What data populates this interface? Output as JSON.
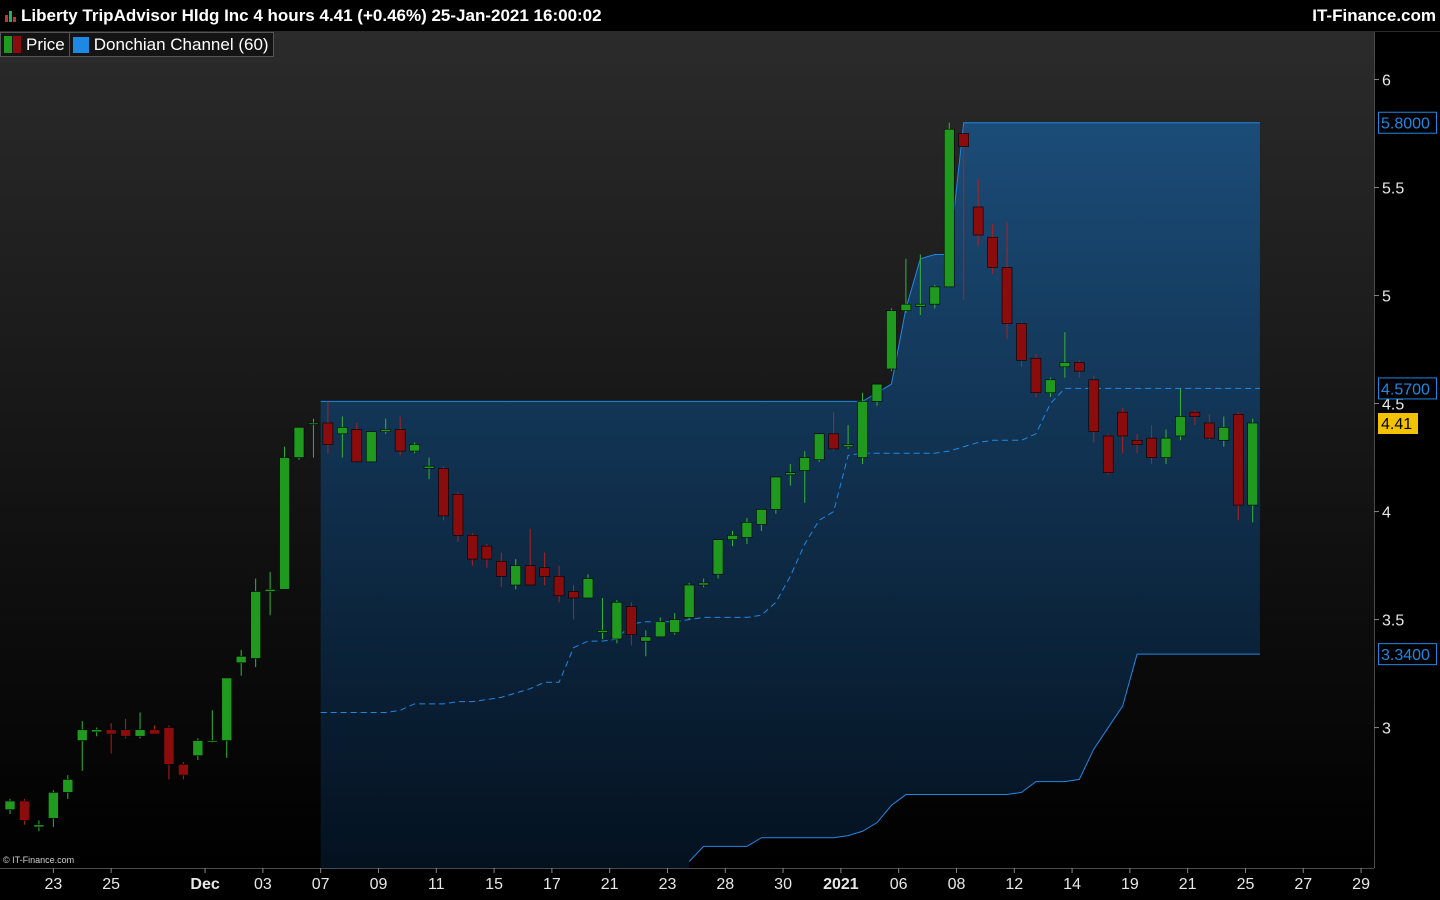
{
  "header": {
    "title": "Liberty TripAdvisor Hldg Inc 4 hours 4.41 (+0.46%) 25-Jan-2021 16:00:02",
    "brand": "IT-Finance.com"
  },
  "legend": [
    {
      "label": "Price",
      "icon": "candlestick-icon"
    },
    {
      "label": "Donchian Channel (60)",
      "icon": "blue-square-icon",
      "color": "#1e88e5"
    }
  ],
  "copyright": "© IT-Finance.com",
  "colors": {
    "up": "#1f9a1f",
    "down": "#8a0c0c",
    "channel": "#1e88e5",
    "last_price_bg": "#f2c200"
  },
  "chart_data": {
    "type": "candlestick",
    "title": "Liberty TripAdvisor Hldg Inc 4 hours",
    "ylim": [
      2.35,
      6.22
    ],
    "y_ticks": [
      {
        "value": 3,
        "label": "3"
      },
      {
        "value": 3.5,
        "label": "3.5"
      },
      {
        "value": 4,
        "label": "4"
      },
      {
        "value": 4.5,
        "label": "4.5"
      },
      {
        "value": 5,
        "label": "5"
      },
      {
        "value": 5.5,
        "label": "5.5"
      },
      {
        "value": 6,
        "label": "6"
      }
    ],
    "x_ticks": [
      {
        "index": 3,
        "label": "23",
        "bold": false
      },
      {
        "index": 7,
        "label": "25",
        "bold": false
      },
      {
        "index": 13.5,
        "label": "Dec",
        "bold": true
      },
      {
        "index": 17.5,
        "label": "03",
        "bold": false
      },
      {
        "index": 21.5,
        "label": "07",
        "bold": false
      },
      {
        "index": 25.5,
        "label": "09",
        "bold": false
      },
      {
        "index": 29.5,
        "label": "11",
        "bold": false
      },
      {
        "index": 33.5,
        "label": "15",
        "bold": false
      },
      {
        "index": 37.5,
        "label": "17",
        "bold": false
      },
      {
        "index": 41.5,
        "label": "21",
        "bold": false
      },
      {
        "index": 45.5,
        "label": "23",
        "bold": false
      },
      {
        "index": 49.5,
        "label": "28",
        "bold": false
      },
      {
        "index": 53.5,
        "label": "30",
        "bold": false
      },
      {
        "index": 57.5,
        "label": "2021",
        "bold": true
      },
      {
        "index": 61.5,
        "label": "06",
        "bold": false
      },
      {
        "index": 65.5,
        "label": "08",
        "bold": false
      },
      {
        "index": 69.5,
        "label": "12",
        "bold": false
      },
      {
        "index": 73.5,
        "label": "14",
        "bold": false
      },
      {
        "index": 77.5,
        "label": "19",
        "bold": false
      },
      {
        "index": 81.5,
        "label": "21",
        "bold": false
      },
      {
        "index": 85.5,
        "label": "25",
        "bold": false
      },
      {
        "index": 89.5,
        "label": "27",
        "bold": false
      },
      {
        "index": 93.5,
        "label": "29",
        "bold": false
      }
    ],
    "candles": [
      [
        2.62,
        2.67,
        2.6,
        2.66
      ],
      [
        2.66,
        2.67,
        2.55,
        2.57
      ],
      [
        2.54,
        2.57,
        2.52,
        2.55
      ],
      [
        2.58,
        2.71,
        2.54,
        2.7
      ],
      [
        2.7,
        2.78,
        2.67,
        2.76
      ],
      [
        2.94,
        3.03,
        2.8,
        2.99
      ],
      [
        2.98,
        3.0,
        2.96,
        2.99
      ],
      [
        2.99,
        3.02,
        2.88,
        2.97
      ],
      [
        2.99,
        3.04,
        2.95,
        2.96
      ],
      [
        2.96,
        3.07,
        2.95,
        2.99
      ],
      [
        2.99,
        3.01,
        2.97,
        2.97
      ],
      [
        3.0,
        3.01,
        2.76,
        2.83
      ],
      [
        2.83,
        2.84,
        2.76,
        2.78
      ],
      [
        2.87,
        2.95,
        2.85,
        2.94
      ],
      [
        2.94,
        3.08,
        2.93,
        2.94
      ],
      [
        2.94,
        3.23,
        2.86,
        3.23
      ],
      [
        3.3,
        3.36,
        3.24,
        3.33
      ],
      [
        3.32,
        3.69,
        3.28,
        3.63
      ],
      [
        3.63,
        3.72,
        3.52,
        3.64
      ],
      [
        3.64,
        4.3,
        3.64,
        4.25
      ],
      [
        4.25,
        4.39,
        4.24,
        4.39
      ],
      [
        4.41,
        4.43,
        4.25,
        4.41
      ],
      [
        4.41,
        4.51,
        4.27,
        4.31
      ],
      [
        4.36,
        4.44,
        4.25,
        4.39
      ],
      [
        4.38,
        4.41,
        4.25,
        4.23
      ],
      [
        4.23,
        4.37,
        4.25,
        4.37
      ],
      [
        4.37,
        4.43,
        4.36,
        4.38
      ],
      [
        4.38,
        4.44,
        4.26,
        4.28
      ],
      [
        4.28,
        4.32,
        4.27,
        4.31
      ],
      [
        4.2,
        4.25,
        4.15,
        4.21
      ],
      [
        4.2,
        4.21,
        3.96,
        3.98
      ],
      [
        4.08,
        4.09,
        3.86,
        3.89
      ],
      [
        3.89,
        3.9,
        3.75,
        3.78
      ],
      [
        3.84,
        3.85,
        3.74,
        3.78
      ],
      [
        3.77,
        3.81,
        3.65,
        3.7
      ],
      [
        3.66,
        3.78,
        3.64,
        3.75
      ],
      [
        3.75,
        3.92,
        3.72,
        3.66
      ],
      [
        3.74,
        3.81,
        3.66,
        3.7
      ],
      [
        3.7,
        3.75,
        3.58,
        3.61
      ],
      [
        3.63,
        3.66,
        3.5,
        3.6
      ],
      [
        3.6,
        3.71,
        3.6,
        3.69
      ],
      [
        3.44,
        3.6,
        3.41,
        3.45
      ],
      [
        3.41,
        3.59,
        3.39,
        3.58
      ],
      [
        3.56,
        3.58,
        3.38,
        3.43
      ],
      [
        3.4,
        3.45,
        3.33,
        3.42
      ],
      [
        3.42,
        3.51,
        3.42,
        3.49
      ],
      [
        3.44,
        3.53,
        3.43,
        3.5
      ],
      [
        3.51,
        3.67,
        3.5,
        3.66
      ],
      [
        3.66,
        3.69,
        3.65,
        3.67
      ],
      [
        3.71,
        3.87,
        3.69,
        3.87
      ],
      [
        3.87,
        3.91,
        3.84,
        3.89
      ],
      [
        3.88,
        3.97,
        3.85,
        3.95
      ],
      [
        3.94,
        4.0,
        3.91,
        4.01
      ],
      [
        4.01,
        4.16,
        3.99,
        4.16
      ],
      [
        4.17,
        4.22,
        4.12,
        4.18
      ],
      [
        4.19,
        4.28,
        4.04,
        4.25
      ],
      [
        4.24,
        4.36,
        4.23,
        4.36
      ],
      [
        4.36,
        4.46,
        4.28,
        4.29
      ],
      [
        4.3,
        4.4,
        4.29,
        4.31
      ],
      [
        4.25,
        4.55,
        4.22,
        4.51
      ],
      [
        4.51,
        4.59,
        4.49,
        4.59
      ],
      [
        4.66,
        4.94,
        4.65,
        4.93
      ],
      [
        4.93,
        5.17,
        4.92,
        4.96
      ],
      [
        4.95,
        5.19,
        4.91,
        4.96
      ],
      [
        4.96,
        5.05,
        4.94,
        5.04
      ],
      [
        5.04,
        5.8,
        5.04,
        5.77
      ],
      [
        5.75,
        5.78,
        4.98,
        5.69
      ],
      [
        5.41,
        5.54,
        5.23,
        5.28
      ],
      [
        5.27,
        5.33,
        5.1,
        5.13
      ],
      [
        5.13,
        5.34,
        4.8,
        4.87
      ],
      [
        4.87,
        4.88,
        4.67,
        4.7
      ],
      [
        4.71,
        4.73,
        4.53,
        4.55
      ],
      [
        4.55,
        4.62,
        4.53,
        4.61
      ],
      [
        4.67,
        4.83,
        4.62,
        4.69
      ],
      [
        4.69,
        4.7,
        4.62,
        4.65
      ],
      [
        4.61,
        4.63,
        4.32,
        4.37
      ],
      [
        4.35,
        4.36,
        4.17,
        4.18
      ],
      [
        4.46,
        4.48,
        4.27,
        4.35
      ],
      [
        4.33,
        4.36,
        4.27,
        4.31
      ],
      [
        4.34,
        4.4,
        4.22,
        4.25
      ],
      [
        4.25,
        4.38,
        4.22,
        4.34
      ],
      [
        4.35,
        4.57,
        4.33,
        4.44
      ],
      [
        4.46,
        4.47,
        4.4,
        4.44
      ],
      [
        4.41,
        4.45,
        4.33,
        4.34
      ],
      [
        4.33,
        4.44,
        4.3,
        4.39
      ],
      [
        4.45,
        4.46,
        3.96,
        4.03
      ],
      [
        4.03,
        4.43,
        3.95,
        4.41
      ]
    ],
    "donchian_start_index": 22,
    "donchian_upper": [
      4.51,
      4.51,
      4.51,
      4.51,
      4.51,
      4.51,
      4.51,
      4.51,
      4.51,
      4.51,
      4.51,
      4.51,
      4.51,
      4.51,
      4.51,
      4.51,
      4.51,
      4.51,
      4.51,
      4.51,
      4.51,
      4.51,
      4.51,
      4.51,
      4.51,
      4.51,
      4.51,
      4.51,
      4.51,
      4.51,
      4.51,
      4.51,
      4.51,
      4.51,
      4.51,
      4.51,
      4.51,
      4.51,
      4.55,
      4.59,
      4.94,
      5.17,
      5.19,
      5.19,
      5.8,
      5.8,
      5.8,
      5.8,
      5.8,
      5.8,
      5.8,
      5.8,
      5.8,
      5.8,
      5.8,
      5.8,
      5.8,
      5.8,
      5.8,
      5.8,
      5.8,
      5.8,
      5.8,
      5.8,
      5.8
    ],
    "donchian_lower": [
      null,
      null,
      null,
      null,
      null,
      null,
      null,
      null,
      null,
      null,
      null,
      null,
      null,
      null,
      null,
      null,
      null,
      null,
      null,
      null,
      null,
      null,
      null,
      null,
      null,
      2.38,
      2.45,
      2.45,
      2.45,
      2.45,
      2.49,
      2.49,
      2.49,
      2.49,
      2.49,
      2.49,
      2.5,
      2.52,
      2.56,
      2.64,
      2.69,
      2.69,
      2.69,
      2.69,
      2.69,
      2.69,
      2.69,
      2.69,
      2.7,
      2.75,
      2.75,
      2.75,
      2.76,
      2.9,
      3.0,
      3.1,
      3.34,
      3.34,
      3.34,
      3.34,
      3.34,
      3.34,
      3.34,
      3.34,
      3.34
    ],
    "donchian_middle": [
      3.07,
      3.07,
      3.07,
      3.07,
      3.07,
      3.08,
      3.11,
      3.11,
      3.11,
      3.12,
      3.12,
      3.13,
      3.14,
      3.16,
      3.18,
      3.21,
      3.21,
      3.37,
      3.4,
      3.4,
      3.41,
      3.48,
      3.49,
      3.49,
      3.49,
      3.5,
      3.51,
      3.51,
      3.51,
      3.51,
      3.52,
      3.58,
      3.7,
      3.85,
      3.96,
      4.0,
      4.26,
      4.27,
      4.27,
      4.27,
      4.27,
      4.27,
      4.27,
      4.28,
      4.3,
      4.32,
      4.33,
      4.33,
      4.33,
      4.36,
      4.5,
      4.57,
      4.57,
      4.57,
      4.57,
      4.57,
      4.57,
      4.57,
      4.57,
      4.57,
      4.57,
      4.57,
      4.57,
      4.57,
      4.57
    ],
    "price_labels": [
      {
        "value": 5.8,
        "text": "5.8000",
        "kind": "channel"
      },
      {
        "value": 4.57,
        "text": "4.5700",
        "kind": "channel"
      },
      {
        "value": 4.41,
        "text": "4.41",
        "kind": "last"
      },
      {
        "value": 3.34,
        "text": "3.3400",
        "kind": "channel"
      }
    ]
  }
}
